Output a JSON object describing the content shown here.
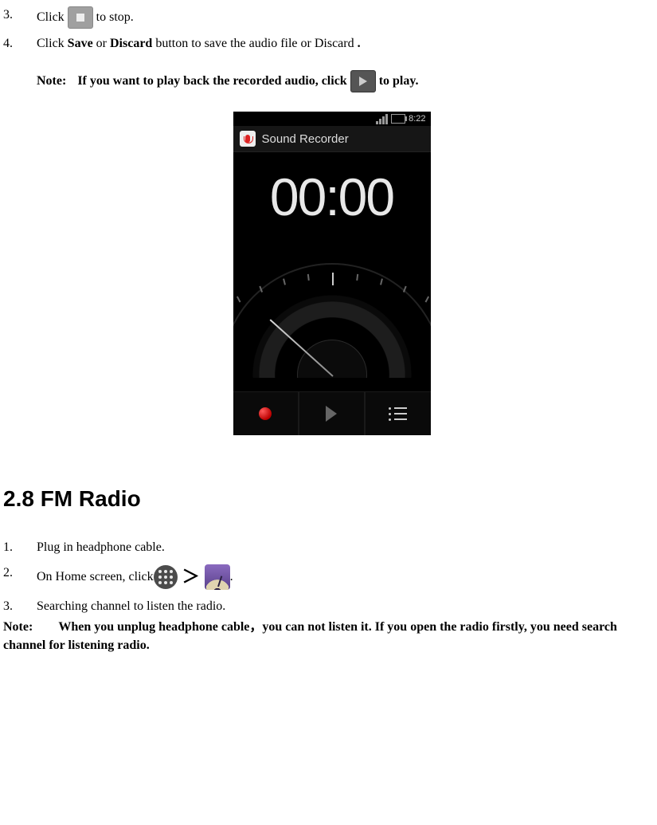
{
  "steps_top": {
    "s3_num": "3.",
    "s3_a": "Click ",
    "s3_b": " to stop.",
    "s4_num": "4.",
    "s4_a": "Click ",
    "s4_save": "Save",
    "s4_b": " or ",
    "s4_discard": "Discard",
    "s4_c": " button to save the audio file or Discard",
    "s4_d": "."
  },
  "note1": {
    "label": "Note:",
    "a": "If you want to play back the recorded audio, click ",
    "b": " to play."
  },
  "phone": {
    "clock": "8:22",
    "title": "Sound Recorder",
    "time": "00:00"
  },
  "section": "2.8 FM Radio",
  "fm": {
    "s1_num": "1.",
    "s1": "Plug in headphone cable.",
    "s2_num": "2.",
    "s2_a": "On Home screen, click ",
    "s2_b": ".",
    "arrow": "＞",
    "s3_num": "3.",
    "s3": "Searching channel to listen the radio."
  },
  "note2": {
    "label": "Note:",
    "text": "When you unplug headphone cable，you can not listen it. If you open the radio firstly, you need search channel for listening radio."
  }
}
